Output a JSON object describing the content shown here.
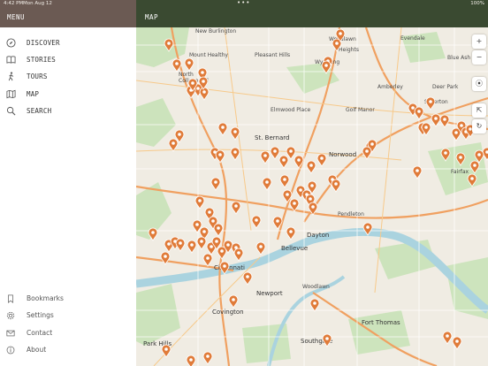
{
  "status": {
    "time": "4:42 PM",
    "date": "Mon Aug 12",
    "right": "100%"
  },
  "sidebar": {
    "header": "MENU",
    "items": [
      {
        "label": "DISCOVER",
        "icon": "compass-icon"
      },
      {
        "label": "STORIES",
        "icon": "book-icon"
      },
      {
        "label": "TOURS",
        "icon": "walking-icon"
      },
      {
        "label": "MAP",
        "icon": "map-icon"
      },
      {
        "label": "SEARCH",
        "icon": "search-icon"
      }
    ],
    "bottom": [
      {
        "label": "Bookmarks",
        "icon": "bookmark-icon"
      },
      {
        "label": "Settings",
        "icon": "gear-icon"
      },
      {
        "label": "Contact",
        "icon": "mail-icon"
      },
      {
        "label": "About",
        "icon": "info-icon"
      }
    ]
  },
  "map": {
    "title": "MAP",
    "labels": [
      {
        "text": "New Burlington"
      },
      {
        "text": "Woodlawn"
      },
      {
        "text": "Evendale"
      },
      {
        "text": "Mount Healthy"
      },
      {
        "text": "Pleasant Hills"
      },
      {
        "text": "Wyoming"
      },
      {
        "text": "Heights"
      },
      {
        "text": "Blue Ash"
      },
      {
        "text": "North College Hill"
      },
      {
        "text": "Amberley"
      },
      {
        "text": "Deer Park"
      },
      {
        "text": "Elmwood Place"
      },
      {
        "text": "Golf Manor"
      },
      {
        "text": "Silverton"
      },
      {
        "text": "St. Bernard"
      },
      {
        "text": "Norwood"
      },
      {
        "text": "Fairfax"
      },
      {
        "text": "Pendleton"
      },
      {
        "text": "Dayton"
      },
      {
        "text": "Bellevue"
      },
      {
        "text": "Cincinnati"
      },
      {
        "text": "Newport"
      },
      {
        "text": "Woodlawn"
      },
      {
        "text": "Covington"
      },
      {
        "text": "Fort Thomas"
      },
      {
        "text": "Park Hills"
      },
      {
        "text": "Southgate"
      }
    ],
    "controls": [
      "+",
      "−",
      "⦿",
      "⇱",
      "↻"
    ],
    "accent": "#e07b39"
  }
}
